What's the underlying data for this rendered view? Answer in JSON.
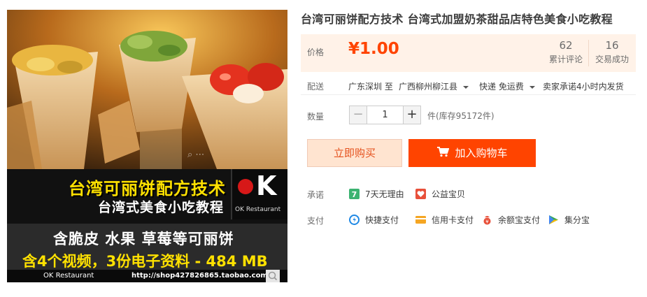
{
  "image": {
    "banner_line1": "台湾可丽饼配方技术",
    "banner_line2": "台湾式美食小吃教程",
    "logo_mark": "K",
    "logo_name": "OK Restaurant",
    "tagline_line1": "含脆皮  水果  草莓等可丽饼",
    "tagline_line2": "含4个视频，3份电子资料  -  484 MB",
    "footer_left": "OK Restaurant",
    "footer_right": "http://shop427826865.taobao.com",
    "colors": {
      "banner_yellow": "#ffe100",
      "logo_red": "#d71818"
    }
  },
  "product": {
    "title": "台湾可丽饼配方技术 台湾式加盟奶茶甜品店特色美食小吃教程"
  },
  "price": {
    "label": "价格",
    "value": "¥1.00",
    "reviews_count": "62",
    "reviews_label": "累计评论",
    "sales_count": "16",
    "sales_label": "交易成功"
  },
  "delivery": {
    "label": "配送",
    "from": "广东深圳 至",
    "to": "广西柳州柳江县",
    "method": "快递 免运费",
    "promise": "卖家承诺4小时内发货"
  },
  "quantity": {
    "label": "数量",
    "minus": "−",
    "plus": "+",
    "value": "1",
    "stock": "件(库存95172件)"
  },
  "actions": {
    "buy_now": "立即购买",
    "add_to_cart": "加入购物车"
  },
  "commitment": {
    "label": "承诺",
    "items": [
      {
        "icon": "seven-day-return-icon",
        "label": "7天无理由"
      },
      {
        "icon": "charity-heart-icon",
        "label": "公益宝贝"
      }
    ]
  },
  "payment": {
    "label": "支付",
    "items": [
      {
        "icon": "quick-pay-icon",
        "label": "快捷支付"
      },
      {
        "icon": "credit-card-icon",
        "label": "信用卡支付"
      },
      {
        "icon": "yuebao-icon",
        "label": "余额宝支付"
      },
      {
        "icon": "jifenbao-icon",
        "label": "集分宝"
      }
    ]
  },
  "colors": {
    "accent": "#ff4400",
    "price_bg": "#fff2e8",
    "price_text": "#ff4400",
    "buy_now_bg": "#ffe4d0"
  }
}
